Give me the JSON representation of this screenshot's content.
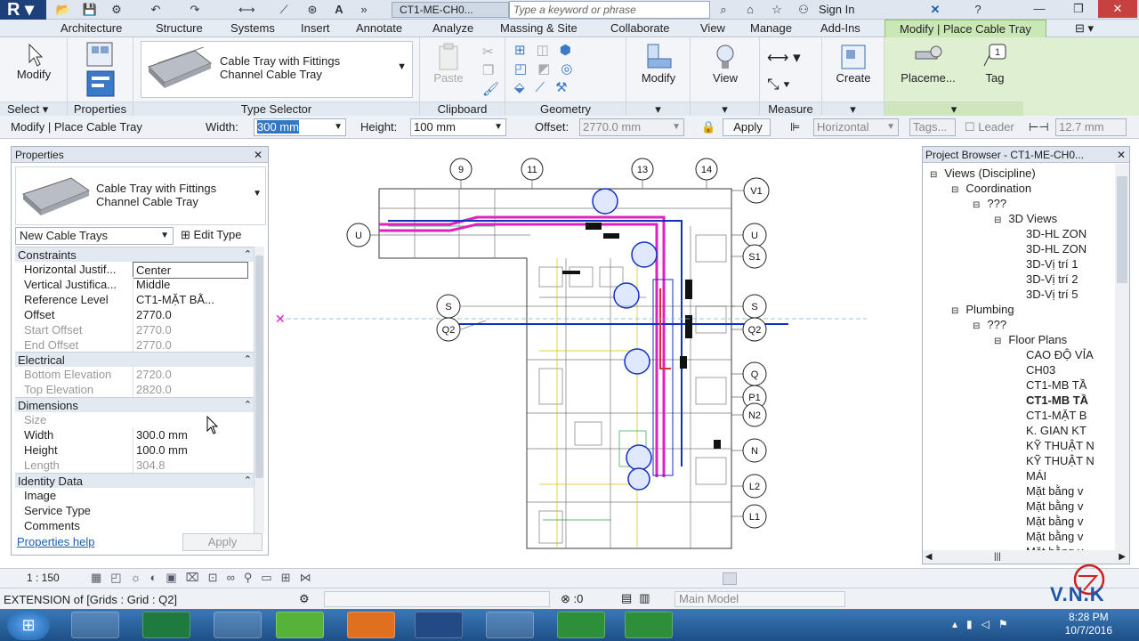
{
  "app": {
    "logo_letter": "R",
    "doc_title": "CT1-ME-CH0...",
    "search_placeholder": "Type a keyword or phrase",
    "sign_in": "Sign In"
  },
  "tabs": [
    "Architecture",
    "Structure",
    "Systems",
    "Insert",
    "Annotate",
    "Analyze",
    "Massing & Site",
    "Collaborate",
    "View",
    "Manage",
    "Add-Ins"
  ],
  "active_tab": "Modify | Place Cable Tray",
  "ribbon": {
    "modify": "Modify",
    "select": "Select",
    "select_caret": "▾",
    "properties": "Properties",
    "type_name_1": "Cable Tray with Fittings",
    "type_name_2": "Channel Cable Tray",
    "type_selector": "Type Selector",
    "paste": "Paste",
    "clipboard": "Clipboard",
    "geometry": "Geometry",
    "modify2": "Modify",
    "view": "View",
    "measure": "Measure",
    "create": "Create",
    "placement": "Placeme...",
    "tag": "Tag"
  },
  "optbar": {
    "context": "Modify | Place Cable Tray",
    "width_label": "Width:",
    "width_value": "300 mm",
    "height_label": "Height:",
    "height_value": "100 mm",
    "offset_label": "Offset:",
    "offset_value": "2770.0 mm",
    "apply": "Apply",
    "justification": "Horizontal",
    "tags": "Tags...",
    "leader": "Leader",
    "leader_len": "12.7 mm"
  },
  "properties": {
    "title": "Properties",
    "type_1": "Cable Tray with Fittings",
    "type_2": "Channel Cable Tray",
    "instance_filter": "New Cable Trays",
    "edit_type": "Edit Type",
    "groups": {
      "constraints": "Constraints",
      "electrical": "Electrical",
      "dimensions": "Dimensions",
      "identity": "Identity Data"
    },
    "rows": {
      "hjust": [
        "Horizontal Justif...",
        "Center"
      ],
      "vjust": [
        "Vertical Justifica...",
        "Middle"
      ],
      "reflevel": [
        "Reference Level",
        "CT1-MẶT BẰ..."
      ],
      "offset": [
        "Offset",
        "2770.0"
      ],
      "startoff": [
        "Start Offset",
        "2770.0"
      ],
      "endoff": [
        "End Offset",
        "2770.0"
      ],
      "botelev": [
        "Bottom Elevation",
        "2720.0"
      ],
      "topelev": [
        "Top Elevation",
        "2820.0"
      ],
      "size": [
        "Size",
        ""
      ],
      "width": [
        "Width",
        "300.0 mm"
      ],
      "height": [
        "Height",
        "100.0 mm"
      ],
      "length": [
        "Length",
        "304.8"
      ],
      "image": [
        "Image",
        ""
      ],
      "service": [
        "Service Type",
        ""
      ],
      "comments": [
        "Comments",
        ""
      ]
    },
    "help": "Properties help",
    "apply": "Apply"
  },
  "grids": {
    "top": [
      "9",
      "11",
      "13",
      "14"
    ],
    "right": [
      "V1",
      "U",
      "S1",
      "S",
      "Q2",
      "Q",
      "P1",
      "N2",
      "N",
      "L2",
      "L1"
    ],
    "left": [
      "U",
      "S",
      "Q2"
    ]
  },
  "browser": {
    "title": "Project Browser - CT1-ME-CH0...",
    "nodes": [
      {
        "t": "Views (Discipline)",
        "lvl": 0,
        "exp": "⊟"
      },
      {
        "t": "Coordination",
        "lvl": 1,
        "exp": "⊟"
      },
      {
        "t": "???",
        "lvl": 2,
        "exp": "⊟"
      },
      {
        "t": "3D Views",
        "lvl": 3,
        "exp": "⊟"
      },
      {
        "t": "3D-HL ZON",
        "lvl": 4,
        "exp": ""
      },
      {
        "t": "3D-HL ZON",
        "lvl": 4,
        "exp": ""
      },
      {
        "t": "3D-Vị trí 1",
        "lvl": 4,
        "exp": ""
      },
      {
        "t": "3D-Vị trí 2",
        "lvl": 4,
        "exp": ""
      },
      {
        "t": "3D-Vị trí 5",
        "lvl": 4,
        "exp": ""
      },
      {
        "t": "Plumbing",
        "lvl": 1,
        "exp": "⊟"
      },
      {
        "t": "???",
        "lvl": 2,
        "exp": "⊟"
      },
      {
        "t": "Floor Plans",
        "lvl": 3,
        "exp": "⊟"
      },
      {
        "t": "CAO ĐỘ VỈA",
        "lvl": 4,
        "exp": ""
      },
      {
        "t": "CH03",
        "lvl": 4,
        "exp": ""
      },
      {
        "t": "CT1-MB TẦ",
        "lvl": 4,
        "exp": ""
      },
      {
        "t": "CT1-MB TẦ",
        "lvl": 4,
        "exp": "",
        "bold": true
      },
      {
        "t": "CT1-MẶT B",
        "lvl": 4,
        "exp": ""
      },
      {
        "t": "K. GIAN KT",
        "lvl": 4,
        "exp": ""
      },
      {
        "t": "KỸ THUẬT N",
        "lvl": 4,
        "exp": ""
      },
      {
        "t": "KỸ THUẬT N",
        "lvl": 4,
        "exp": ""
      },
      {
        "t": "MÁI",
        "lvl": 4,
        "exp": ""
      },
      {
        "t": "Mặt bằng v",
        "lvl": 4,
        "exp": ""
      },
      {
        "t": "Mặt bằng v",
        "lvl": 4,
        "exp": ""
      },
      {
        "t": "Mặt bằng v",
        "lvl": 4,
        "exp": ""
      },
      {
        "t": "Mặt bằng v",
        "lvl": 4,
        "exp": ""
      },
      {
        "t": "Mặt bằng v",
        "lvl": 4,
        "exp": ""
      }
    ]
  },
  "viewbar": {
    "scale": "1 : 150"
  },
  "status": {
    "text": "EXTENSION  of [Grids : Grid : Q2]",
    "zero": ":0",
    "model": "Main Model"
  },
  "watermark": "V.N.K",
  "clock": {
    "time": "8:28 PM",
    "date": "10/7/2016"
  },
  "colors": {
    "ribbon_ctx": "#c9e8b6",
    "tray": "#e020c0",
    "duct": "#1030c0",
    "pipe": "#d83030"
  }
}
